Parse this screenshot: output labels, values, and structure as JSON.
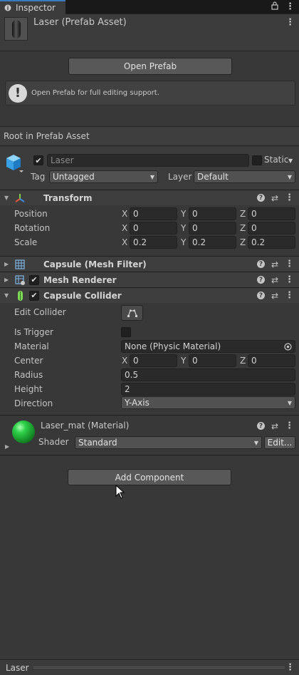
{
  "tab": {
    "label": "Inspector"
  },
  "header": {
    "title": "Laser (Prefab Asset)"
  },
  "prefab": {
    "open_button": "Open Prefab",
    "help_message": "Open Prefab for full editing support.",
    "root_label": "Root in Prefab Asset"
  },
  "gameobject": {
    "name": "Laser",
    "static_label": "Static",
    "tag_label": "Tag",
    "tag_value": "Untagged",
    "layer_label": "Layer",
    "layer_value": "Default"
  },
  "transform": {
    "title": "Transform",
    "rows": [
      {
        "label": "Position",
        "x": "0",
        "y": "0",
        "z": "0"
      },
      {
        "label": "Rotation",
        "x": "0",
        "y": "0",
        "z": "0"
      },
      {
        "label": "Scale",
        "x": "0.2",
        "y": "0.2",
        "z": "0.2"
      }
    ]
  },
  "axes": {
    "x": "X",
    "y": "Y",
    "z": "Z"
  },
  "mesh_filter": {
    "title": "Capsule (Mesh Filter)"
  },
  "mesh_renderer": {
    "title": "Mesh Renderer"
  },
  "capsule_collider": {
    "title": "Capsule Collider",
    "edit_collider_label": "Edit Collider",
    "is_trigger_label": "Is Trigger",
    "material_label": "Material",
    "material_value": "None (Physic Material)",
    "center_label": "Center",
    "center": {
      "x": "0",
      "y": "0",
      "z": "0"
    },
    "radius_label": "Radius",
    "radius_value": "0.5",
    "height_label": "Height",
    "height_value": "2",
    "direction_label": "Direction",
    "direction_value": "Y-Axis"
  },
  "material": {
    "title": "Laser_mat (Material)",
    "shader_label": "Shader",
    "shader_value": "Standard",
    "edit_button": "Edit..."
  },
  "add_component": "Add Component",
  "footer": {
    "name": "Laser"
  },
  "colors": {
    "background": "#383838",
    "tab_accent": "#3a79bb",
    "field_bg": "#2a2a2a",
    "button_bg": "#585858"
  }
}
